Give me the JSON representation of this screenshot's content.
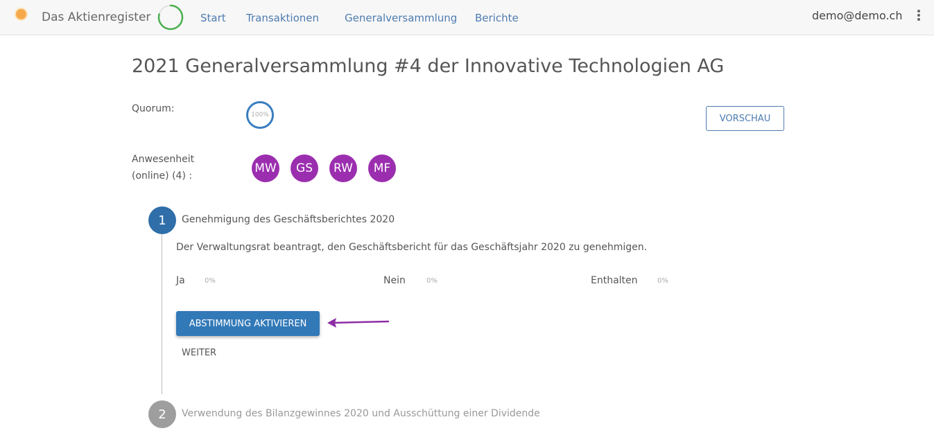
{
  "colors": {
    "primary": "#3279b8",
    "accent_purple": "#9b2eaf",
    "nav_link": "#4d7bb0",
    "step_inactive": "#9e9e9e",
    "progress_ring": "#4caf50"
  },
  "header": {
    "logo_icon": "sun-logo-icon",
    "app_title": "Das Aktienregister",
    "nav": [
      {
        "label": "Start"
      },
      {
        "label": "Transaktionen"
      },
      {
        "label": "Generalversammlung"
      },
      {
        "label": "Berichte"
      }
    ],
    "user_email": "demo@demo.ch",
    "menu_icon": "kebab-menu-icon"
  },
  "page": {
    "title": "2021 Generalversammlung #4 der Innovative Technologien AG",
    "quorum_label": "Quorum:",
    "quorum_value": "100%",
    "preview_button": "VORSCHAU",
    "attendance_label_line1": "Anwesenheit",
    "attendance_label_line2": "(online) (4) :",
    "attendees": [
      {
        "initials": "MW"
      },
      {
        "initials": "GS"
      },
      {
        "initials": "RW"
      },
      {
        "initials": "MF"
      }
    ]
  },
  "agenda": {
    "items": [
      {
        "number": "1",
        "title": "Genehmigung des Geschäftsberichtes 2020",
        "description": "Der Verwaltungsrat beantragt, den Geschäftsbericht für das Geschäftsjahr 2020 zu genehmigen.",
        "votes": [
          {
            "label": "Ja",
            "percent": "0%"
          },
          {
            "label": "Nein",
            "percent": "0%"
          },
          {
            "label": "Enthalten",
            "percent": "0%"
          }
        ],
        "activate_button": "ABSTIMMUNG AKTIVIEREN",
        "next_button": "WEITER"
      },
      {
        "number": "2",
        "title": "Verwendung des Bilanzgewinnes 2020 und Ausschüttung einer Dividende"
      }
    ]
  }
}
